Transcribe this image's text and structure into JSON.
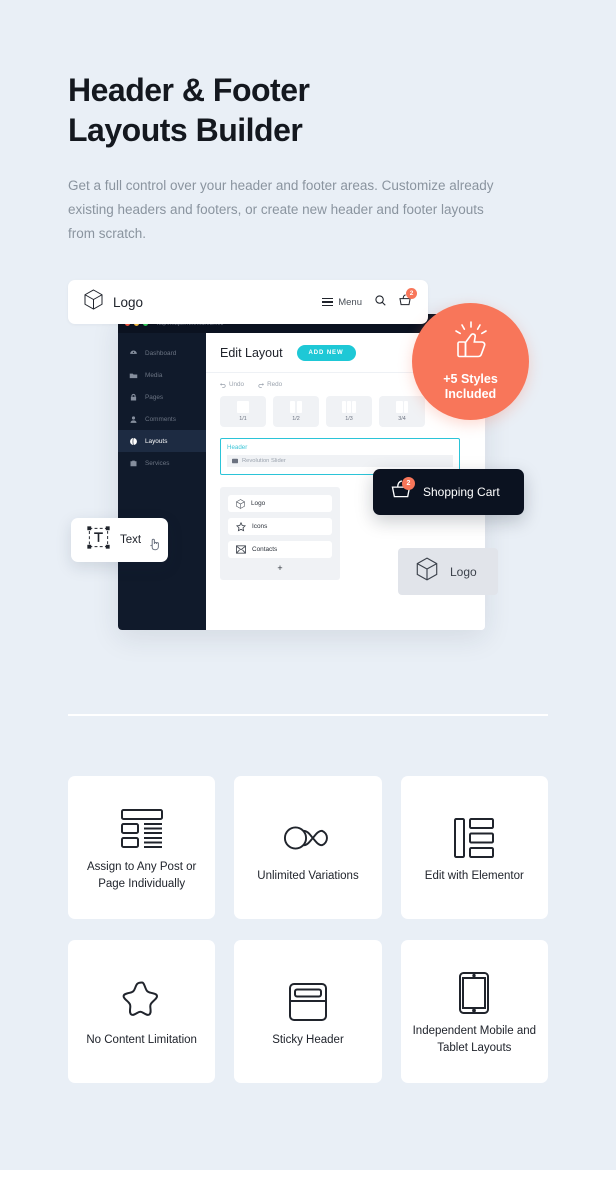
{
  "hero": {
    "title_line1": "Header & Footer",
    "title_line2": "Layouts Builder",
    "description": "Get a full control over your header and footer areas. Customize already existing headers and footers, or create new header and footer layouts from scratch."
  },
  "site_header": {
    "logo_label": "Logo",
    "menu_label": "Menu",
    "cart_badge": "2",
    "icons": [
      "cube-icon",
      "hamburger-icon",
      "search-icon",
      "cart-icon"
    ]
  },
  "browser": {
    "url": "http://https://themarea.net/",
    "sidebar": [
      {
        "label": "Dashboard",
        "icon": "gauge-icon",
        "active": false
      },
      {
        "label": "Media",
        "icon": "folder-icon",
        "active": false
      },
      {
        "label": "Pages",
        "icon": "lock-icon",
        "active": false
      },
      {
        "label": "Comments",
        "icon": "user-icon",
        "active": false
      },
      {
        "label": "Layouts",
        "icon": "globe-icon",
        "active": true
      },
      {
        "label": "Services",
        "icon": "briefcase-icon",
        "active": false
      }
    ],
    "content_title": "Edit Layout",
    "add_new_label": "ADD NEW",
    "undo_label": "Undo",
    "redo_label": "Redo",
    "columns": [
      {
        "label": "1/1",
        "parts": 1
      },
      {
        "label": "1/2",
        "parts": 2
      },
      {
        "label": "1/3",
        "parts": 3
      },
      {
        "label": "3/4",
        "parts": 2
      }
    ],
    "header_box_label": "Header",
    "widget_label": "Revolution Slider",
    "panel_items": [
      {
        "label": "Logo",
        "icon": "cube-icon"
      },
      {
        "label": "Icons",
        "icon": "star-icon"
      },
      {
        "label": "Contacts",
        "icon": "envelope-icon"
      }
    ],
    "panel_add_label": "+"
  },
  "chips": {
    "text_label": "Text",
    "cart_label": "Shopping Cart",
    "cart_badge": "2",
    "logo_label": "Logo"
  },
  "badge": {
    "line1": "+5 Styles",
    "line2": "Included",
    "icon": "thumbs-up-icon",
    "color": "#f8765a"
  },
  "features": [
    {
      "label": "Assign to Any Post or Page Individually",
      "icon": "layout-list-icon"
    },
    {
      "label": "Unlimited Variations",
      "icon": "infinity-icon"
    },
    {
      "label": "Edit with Elementor",
      "icon": "elementor-icon"
    },
    {
      "label": "No Content Limitation",
      "icon": "star-outline-icon"
    },
    {
      "label": "Sticky Header",
      "icon": "sticky-header-icon"
    },
    {
      "label": "Independent Mobile and Tablet Layouts",
      "icon": "tablet-icon"
    }
  ],
  "theme": {
    "page_bg": "#e9eff6",
    "accent_teal": "#1ec8d6",
    "accent_orange": "#f8765a",
    "dark": "#0b1220"
  }
}
